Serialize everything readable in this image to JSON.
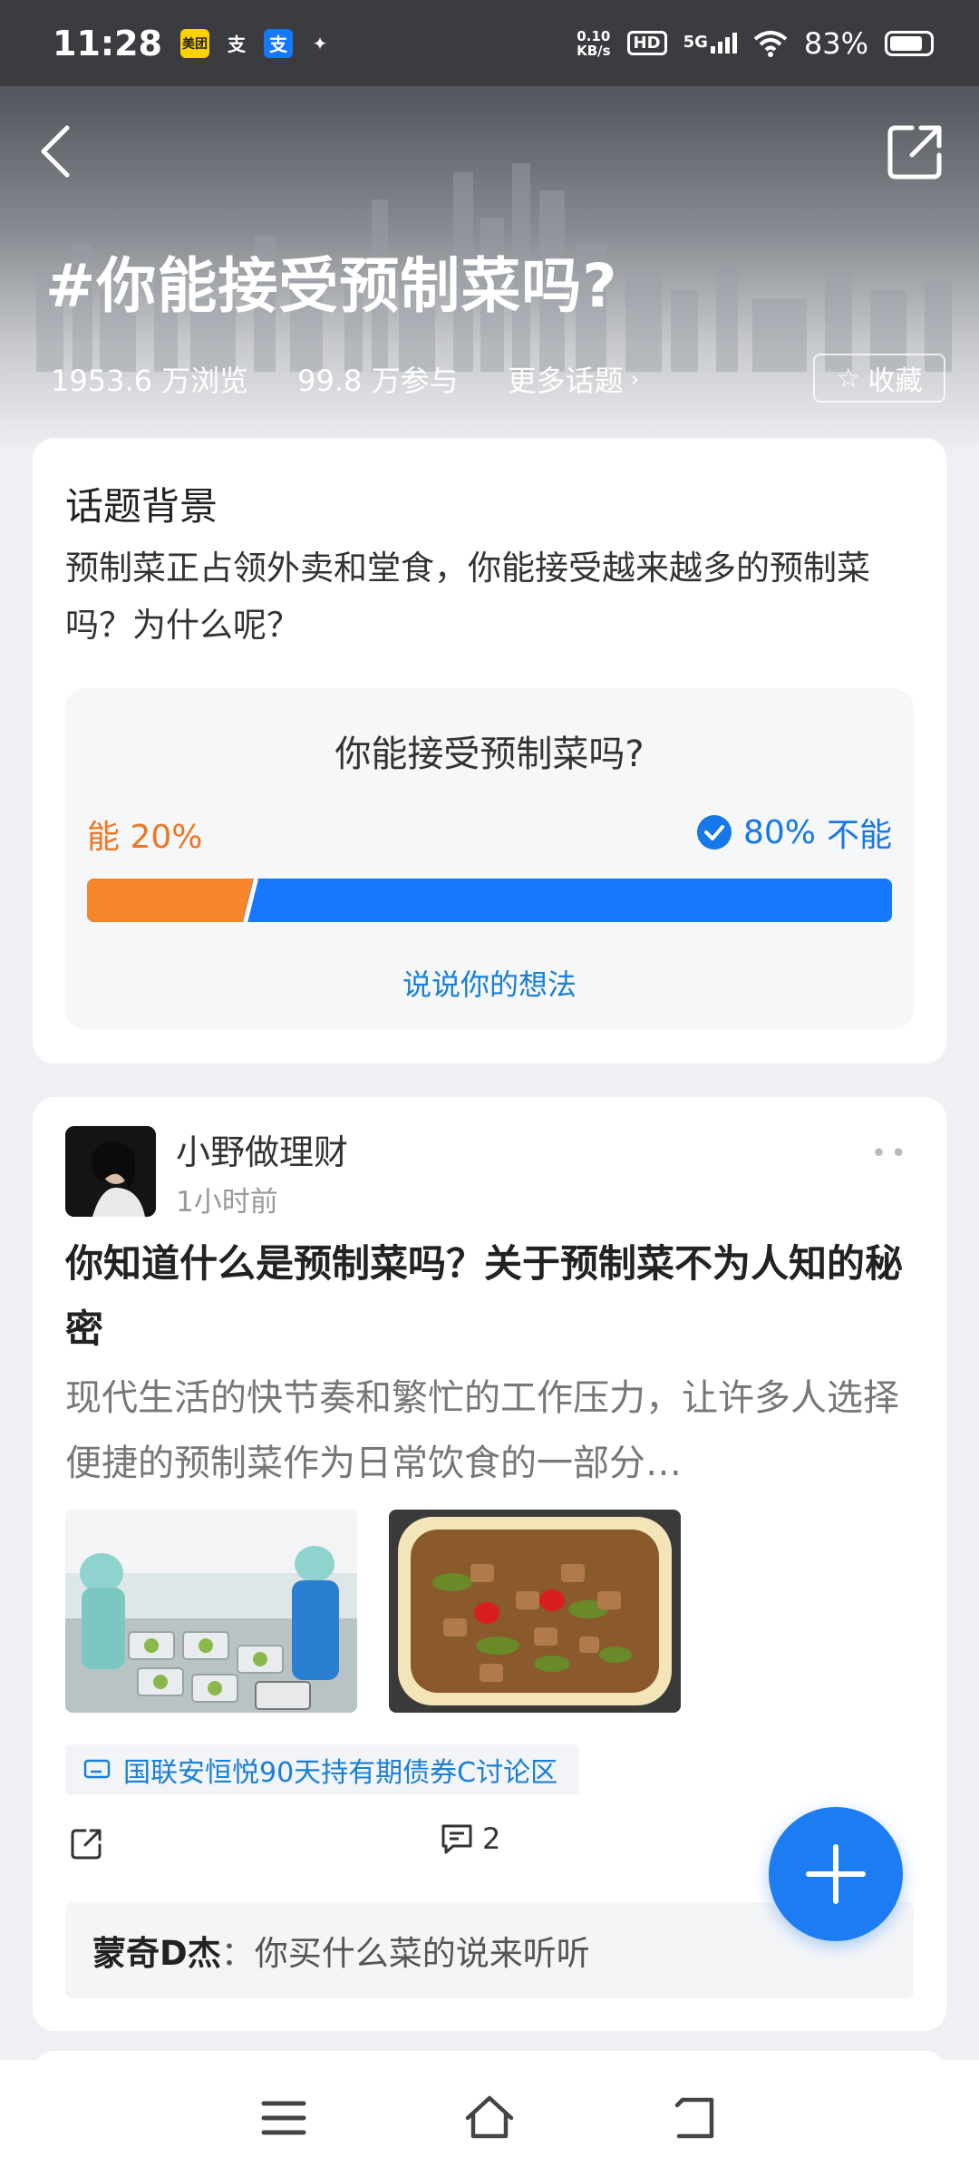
{
  "status_bar": {
    "time": "11:28",
    "net_speed_value": "0.10",
    "net_speed_unit": "KB/s",
    "hd_label": "HD",
    "network": "5G",
    "battery": "83%",
    "battery_level": 0.83,
    "app_icons": [
      "meituan-icon",
      "alipay-icon",
      "alipay-icon",
      "leaf-icon"
    ]
  },
  "header": {
    "title": "#你能接受预制菜吗?",
    "views": "1953.6 万浏览",
    "participants": "99.8 万参与",
    "more_topics": "更多话题",
    "favorite_label": "收藏"
  },
  "background": {
    "title": "话题背景",
    "description": "预制菜正占领外卖和堂食，你能接受越来越多的预制菜吗？为什么呢？"
  },
  "poll": {
    "question": "你能接受预制菜吗?",
    "option_a_label": "能",
    "option_a_percent": "20%",
    "option_b_label": "不能",
    "option_b_percent": "80%",
    "option_a_share": 0.2,
    "option_b_share": 0.8,
    "option_a_color": "#f7852a",
    "option_b_color": "#1677ff",
    "cta": "说说你的想法"
  },
  "post": {
    "author": "小野做理财",
    "time": "1小时前",
    "title": "你知道什么是预制菜吗？关于预制菜不为人知的秘密",
    "excerpt": "现代生活的快节奏和繁忙的工作压力，让许多人选择便捷的预制菜作为日常饮食的一部分…",
    "tag": "国联安恒悦90天持有期债券C讨论区",
    "comment_count": "2",
    "comment_author": "蒙奇D杰",
    "comment_separator": "：",
    "comment_text": "你买什么菜的说来听听"
  },
  "colors": {
    "accent": "#1e7cf2",
    "link": "#1a7fd6",
    "orange": "#f07522"
  }
}
